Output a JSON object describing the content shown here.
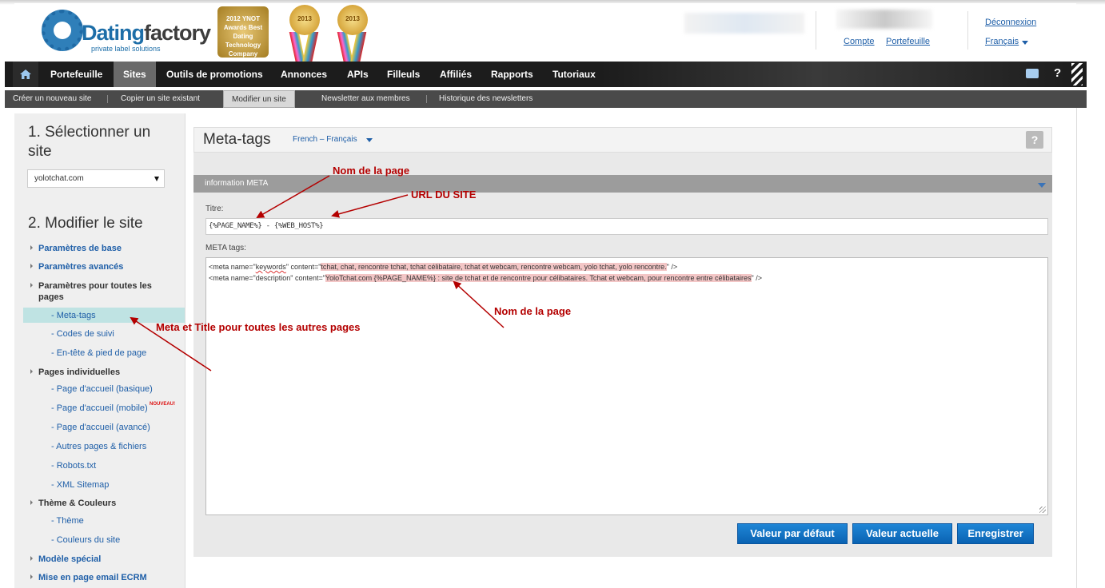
{
  "header": {
    "logo_main": "Dating",
    "logo_bold": "factory",
    "logo_tagline": "private label solutions",
    "award_text": "2012 YNOT Awards Best Dating Technology Company WINNER",
    "ribbon_year_1": "2013",
    "ribbon_year_2": "2013",
    "link_compte": "Compte",
    "link_portefeuille": "Portefeuille",
    "link_deconnexion": "Déconnexion",
    "language": "Français"
  },
  "nav": {
    "items": [
      "Portefeuille",
      "Sites",
      "Outils de promotions",
      "Annonces",
      "APIs",
      "Filleuls",
      "Affiliés",
      "Rapports",
      "Tutoriaux"
    ],
    "active": "Sites",
    "help": "?"
  },
  "subnav": {
    "items": [
      "Créer un nouveau site",
      "Copier un site existant",
      "Modifier un site",
      "Newsletter aux membres",
      "Historique des newsletters"
    ],
    "active": "Modifier un site"
  },
  "sidebar": {
    "step1_line1": "1. Sélectionner un",
    "step1_line2": "site",
    "site_select": "yolotchat.com",
    "step2": "2. Modifier le site",
    "cat_base": "Paramètres de base",
    "cat_advanced": "Paramètres avancés",
    "cat_all_pages": "Paramètres pour toutes les pages",
    "sub_meta": "- Meta-tags",
    "sub_codes": "- Codes de suivi",
    "sub_header_footer": "- En-tête & pied de page",
    "cat_individual": "Pages individuelles",
    "sub_home_basic": "- Page d'accueil (basique)",
    "sub_home_mobile": "- Page d'accueil (mobile)",
    "nouveau_badge": "NOUVEAU!",
    "sub_home_adv": "- Page d'accueil (avancé)",
    "sub_other_pages": "- Autres pages & fichiers",
    "sub_robots": "- Robots.txt",
    "sub_sitemap": "- XML Sitemap",
    "cat_theme": "Thème & Couleurs",
    "sub_theme": "- Thème",
    "sub_colors": "- Couleurs du site",
    "cat_special": "Modèle spécial",
    "cat_email": "Mise en page email ECRM"
  },
  "main": {
    "title": "Meta-tags",
    "language_select": "French – Français",
    "help": "?",
    "section_title": "information META",
    "titre_label": "Titre:",
    "titre_value": "{%PAGE_NAME%} - {%WEB_HOST%}",
    "meta_label": "META tags:",
    "meta_line1_pre": "<meta name=\"",
    "meta_line1_name": "keywords",
    "meta_line1_mid": "\" content=\"",
    "meta_line1_content": "tchat, chat, rencontre tchat, tchat célibataire, tchat et webcam, rencontre webcam, yolo tchat, yolo rencontre.",
    "meta_line1_end": "\" />",
    "meta_line2_pre": "<meta name=\"description\" content=\"",
    "meta_line2_content": "YoloTchat.com {%PAGE_NAME%} : site de tchat et de rencontre pour célibataires. Tchat et webcam, pour rencontre entre célibataires",
    "meta_line2_end": "\" />",
    "btn_default": "Valeur par défaut",
    "btn_current": "Valeur actuelle",
    "btn_save": "Enregistrer"
  },
  "annotations": {
    "nom_page_1": "Nom de la page",
    "url_site": "URL DU SITE",
    "nom_page_2": "Nom de la page",
    "meta_title_all": "Meta et Title pour toutes les autres pages"
  },
  "colors": {
    "annotation": "#b40000",
    "nav_bg": "#1c1c1c",
    "button": "#0a63b3",
    "link": "#1f5fa8"
  }
}
